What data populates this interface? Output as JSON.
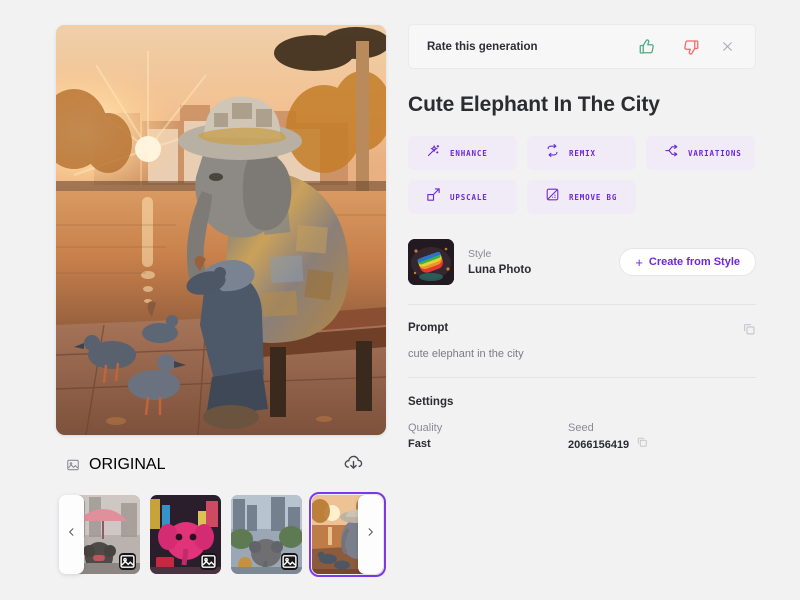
{
  "rate": {
    "label": "Rate this generation",
    "thumbs_up_icon": "thumbs-up-icon",
    "thumbs_down_icon": "thumbs-down-icon",
    "close_icon": "close-icon",
    "up_color": "#4fab85",
    "down_color": "#f26a6a"
  },
  "title": "Cute Elephant In The City",
  "actions": [
    {
      "label": "ENHANCE",
      "icon": "magic-wand-icon"
    },
    {
      "label": "REMIX",
      "icon": "loop-arrows-icon"
    },
    {
      "label": "VARIATIONS",
      "icon": "branch-icon"
    },
    {
      "label": "UPSCALE",
      "icon": "expand-arrow-icon"
    },
    {
      "label": "REMOVE BG",
      "icon": "remove-background-icon"
    }
  ],
  "accent": "#6d28d9",
  "style": {
    "caption": "Style",
    "name": "Luna Photo",
    "create_label": "Create from Style",
    "plus": "+"
  },
  "prompt": {
    "heading": "Prompt",
    "text": "cute elephant in the city",
    "copy_icon": "copy-icon"
  },
  "settings": {
    "heading": "Settings",
    "items": [
      {
        "key": "Quality",
        "value": "Fast",
        "copy": false
      },
      {
        "key": "Seed",
        "value": "2066156419",
        "copy": true
      }
    ]
  },
  "viewer": {
    "original_label": "ORIGINAL",
    "original_icon": "image-icon",
    "download_icon": "cloud-download-icon"
  },
  "thumbnails": {
    "prev_icon": "chevron-left-icon",
    "next_icon": "chevron-right-icon",
    "items": [
      {
        "name": "elephant-rainy-umbrella",
        "selected": false,
        "badge": "image-icon"
      },
      {
        "name": "elephant-pink-neon",
        "selected": false,
        "badge": "image-icon"
      },
      {
        "name": "elephant-city-park",
        "selected": false,
        "badge": "image-icon"
      },
      {
        "name": "elephant-sunset-canal",
        "selected": true,
        "badge": "image-icon"
      }
    ]
  }
}
